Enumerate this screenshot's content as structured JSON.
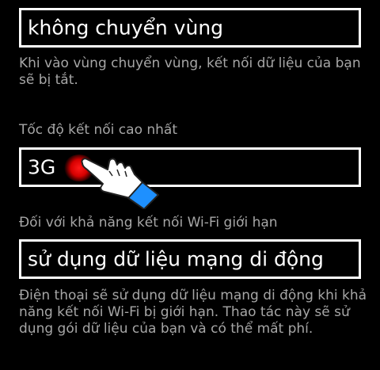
{
  "roaming": {
    "value": "không chuyển vùng",
    "description": "Khi vào vùng chuyển vùng, kết nối dữ liệu của bạn sẽ bị tắt."
  },
  "speed": {
    "label": "Tốc độ kết nối cao nhất",
    "value": "3G"
  },
  "wifi_limited": {
    "label": "Đối với khả năng kết nối Wi-Fi giới hạn",
    "value": "sử dụng dữ liệu mạng di động",
    "description": "Điện thoại sẽ sử dụng dữ liệu mạng di động khi khả năng kết nối Wi-Fi bị giới hạn. Thao tác này sẽ sử dụng gói dữ liệu của bạn và có thể mất phí."
  },
  "overlay": {
    "pointer_icon": "hand-pointer-icon",
    "tap_color": "#e00000",
    "cuff_color": "#1e90ff"
  }
}
